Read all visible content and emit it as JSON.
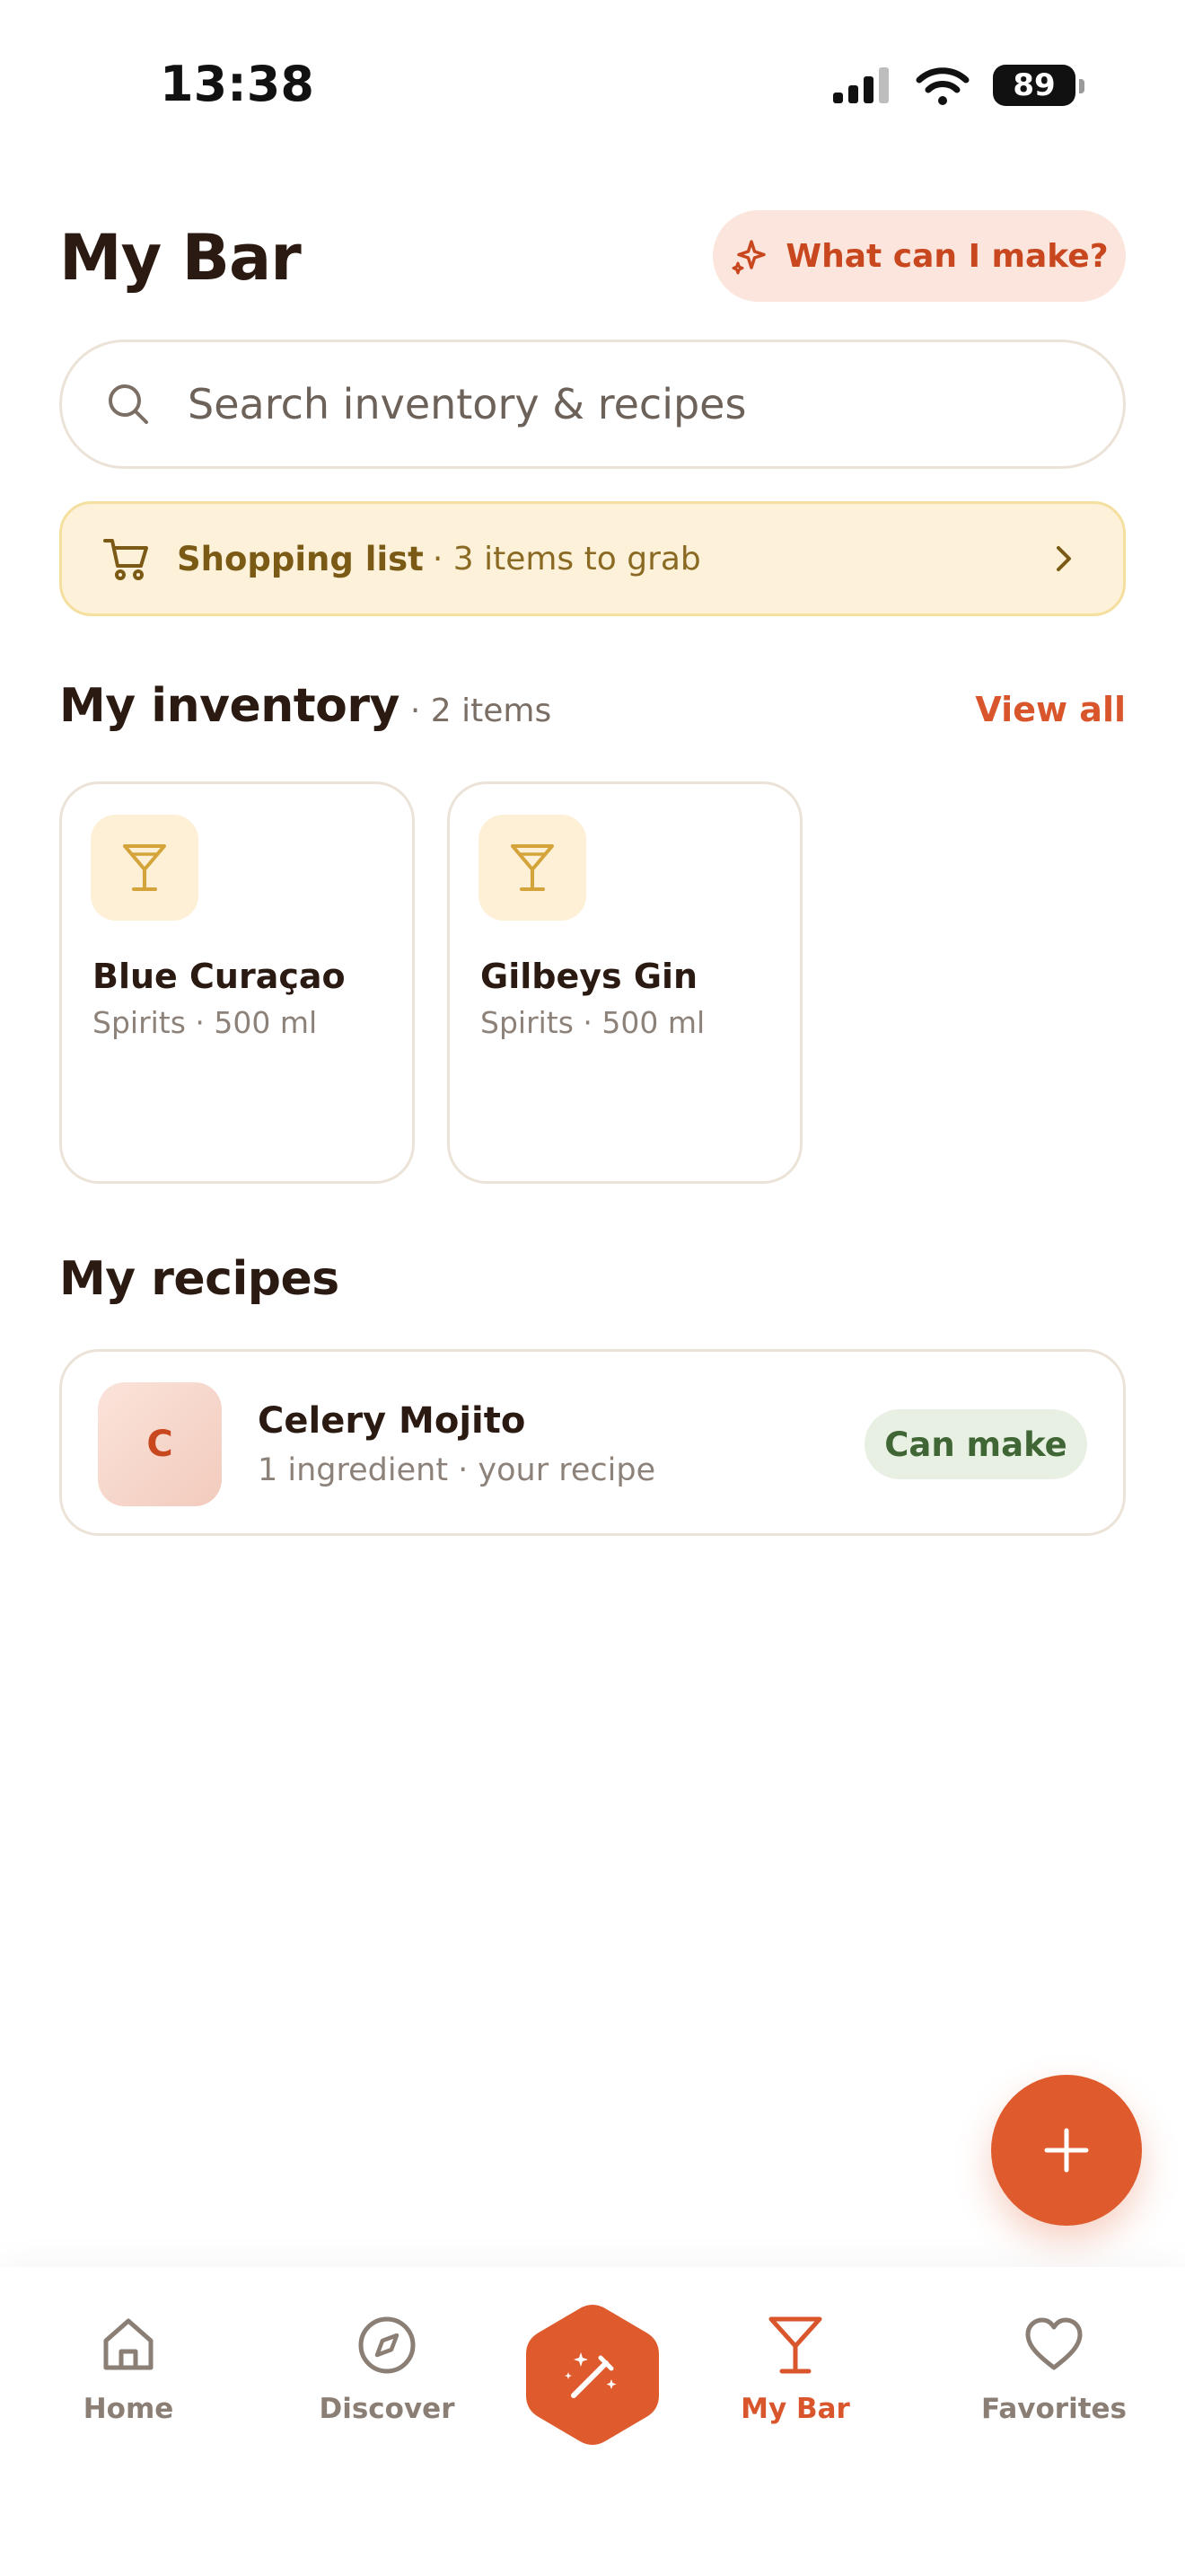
{
  "status_bar": {
    "time": "13:38",
    "battery": "89"
  },
  "header": {
    "title": "My Bar",
    "make_button": "What can I make?",
    "make_icon": "sparkles-icon"
  },
  "search": {
    "placeholder": "Search inventory & recipes"
  },
  "shopping_list": {
    "label": "Shopping list",
    "summary": "· 3 items to grab"
  },
  "inventory": {
    "title": "My inventory",
    "count": "· 2 items",
    "view_all": "View all",
    "items": [
      {
        "name": "Blue Curaçao",
        "meta": "Spirits · 500 ml",
        "icon": "martini-glass-icon"
      },
      {
        "name": "Gilbeys Gin",
        "meta": "Spirits · 500 ml",
        "icon": "martini-glass-icon"
      }
    ]
  },
  "recipes": {
    "title": "My recipes",
    "items": [
      {
        "initial": "C",
        "name": "Celery Mojito",
        "meta": "1 ingredient · your recipe",
        "badge": "Can make"
      }
    ]
  },
  "tabs": [
    {
      "label": "Home",
      "icon": "home-icon",
      "active": false
    },
    {
      "label": "Discover",
      "icon": "compass-icon",
      "active": false
    },
    {
      "label": "My Bar",
      "icon": "martini-glass-icon",
      "active": true
    },
    {
      "label": "Favorites",
      "icon": "heart-icon",
      "active": false
    }
  ],
  "colors": {
    "accent": "#df5a2c",
    "text": "#2b1a12",
    "muted": "#8d827a",
    "shopping_bg": "#fdf2d9",
    "can_make_bg": "#e8f0e4"
  }
}
